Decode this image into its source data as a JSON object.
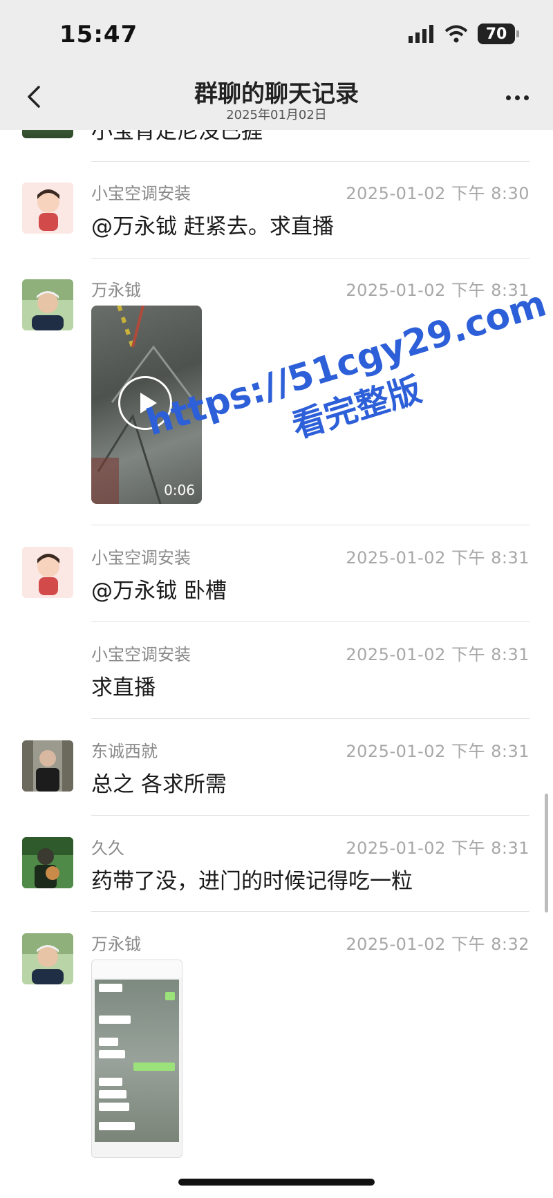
{
  "status": {
    "time": "15:47",
    "battery": "70"
  },
  "nav": {
    "title": "群聊的聊天记录",
    "date": "2025年01月02日"
  },
  "partial_top": {
    "text": "小宝肯定尼没已捱"
  },
  "messages": [
    {
      "sender": "小宝空调安装",
      "time": "2025-01-02 下午 8:30",
      "text": "@万永钺 赶紧去。求直播"
    },
    {
      "sender": "万永钺",
      "time": "2025-01-02 下午 8:31",
      "video_duration": "0:06"
    },
    {
      "sender": "小宝空调安装",
      "time": "2025-01-02 下午 8:31",
      "text": "@万永钺 卧槽"
    },
    {
      "sender": "小宝空调安装",
      "time": "2025-01-02 下午 8:31",
      "text": "求直播"
    },
    {
      "sender": "东诚西就",
      "time": "2025-01-02 下午 8:31",
      "text": "总之 各求所需"
    },
    {
      "sender": "久久",
      "time": "2025-01-02 下午 8:31",
      "text": "药带了没，进门的时候记得吃一粒"
    },
    {
      "sender": "万永钺",
      "time": "2025-01-02 下午 8:32",
      "image": "chat-screenshot"
    }
  ],
  "watermark": {
    "url": "https://51cgy29.com",
    "caption": "看完整版"
  },
  "colors": {
    "accent_watermark": "#2d5fd8",
    "header_bg": "#ededed"
  }
}
